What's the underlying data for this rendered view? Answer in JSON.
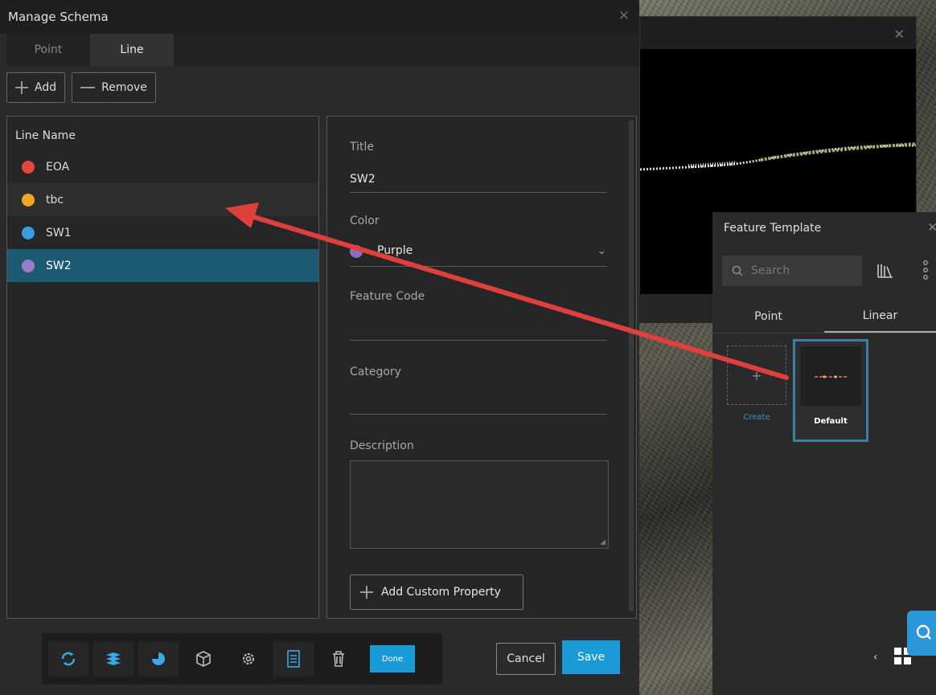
{
  "dialog": {
    "title": "Manage Schema",
    "tabs": [
      {
        "label": "Point"
      },
      {
        "label": "Line"
      }
    ],
    "toolbar": {
      "add_label": "Add",
      "remove_label": "Remove"
    },
    "list": {
      "header": "Line Name",
      "items": [
        {
          "label": "EOA",
          "color": "#e5453b"
        },
        {
          "label": "tbc",
          "color": "#f3a623"
        },
        {
          "label": "SW1",
          "color": "#3a9de0"
        },
        {
          "label": "SW2",
          "color": "#9c7cc8"
        }
      ]
    },
    "form": {
      "title_label": "Title",
      "title_value": "SW2",
      "color_label": "Color",
      "color_value": "Purple",
      "feature_code_label": "Feature Code",
      "category_label": "Category",
      "description_label": "Description",
      "add_custom_property": "Add Custom Property"
    },
    "bottom": {
      "done_label": "Done",
      "cancel_label": "Cancel",
      "save_label": "Save"
    }
  },
  "feature_template": {
    "title": "Feature Template",
    "search_placeholder": "Search",
    "tabs": [
      {
        "label": "Point"
      },
      {
        "label": "Linear"
      }
    ],
    "cards": [
      {
        "label": "Create"
      },
      {
        "label": "Default"
      }
    ]
  },
  "colors": {
    "accent": "#1a9bd8",
    "selected_row": "#1b5a72",
    "annotation_arrow": "#e0403c"
  }
}
